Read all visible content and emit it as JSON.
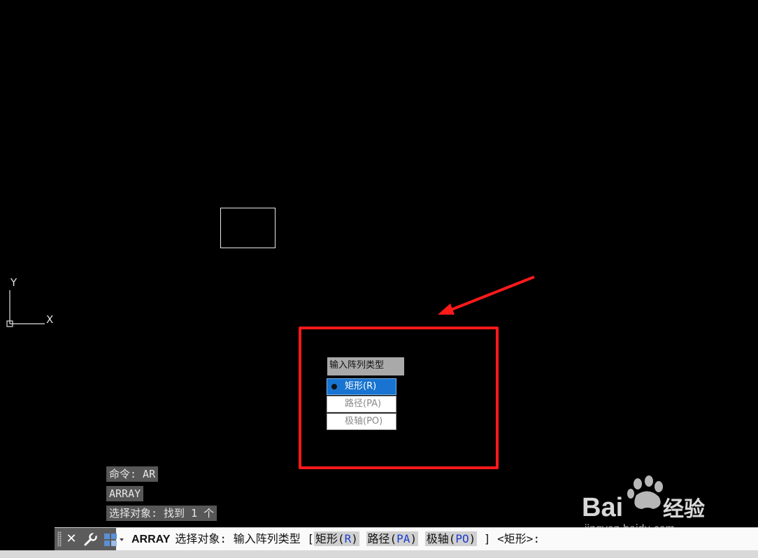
{
  "prompt": {
    "title": "输入阵列类型",
    "options": [
      {
        "label": "矩形(R)",
        "selected": true
      },
      {
        "label": "路径(PA)",
        "selected": false
      },
      {
        "label": "极轴(PO)",
        "selected": false
      }
    ]
  },
  "ucs": {
    "y_label": "Y",
    "x_label": "X"
  },
  "history": [
    "命令: AR",
    "ARRAY",
    "选择对象: 找到 1 个"
  ],
  "command_line": {
    "command": "ARRAY",
    "text_before": "选择对象:  输入阵列类型 [",
    "options": [
      {
        "label": "矩形(",
        "key": "R",
        "close": ")"
      },
      {
        "label": "路径(",
        "key": "PA",
        "close": ")"
      },
      {
        "label": "极轴(",
        "key": "PO",
        "close": ")"
      }
    ],
    "text_after": "] <矩形>:"
  },
  "watermark": {
    "logo": "Bai经验",
    "url": "jingyan.baidu.com"
  },
  "colors": {
    "annotation": "#ff1a1a",
    "selected": "#1874d0",
    "option_key": "#1a3ccf"
  }
}
